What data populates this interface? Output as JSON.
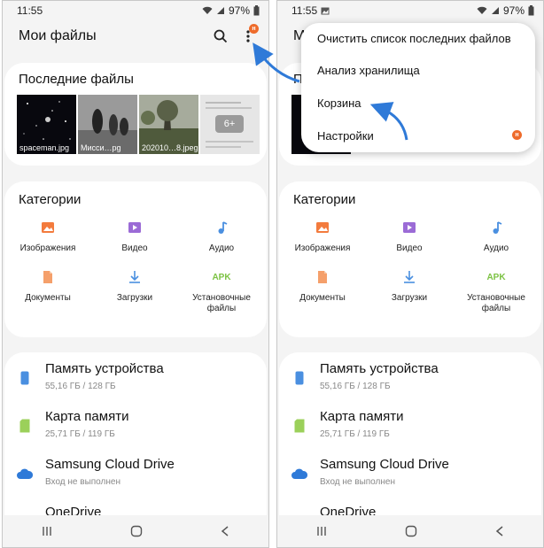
{
  "status": {
    "time": "11:55",
    "battery": "97%"
  },
  "appbar": {
    "title": "Мои файлы",
    "title_partial": "Мо",
    "badge": "н"
  },
  "recent": {
    "title": "Последние файлы",
    "title_partial": "П",
    "files": [
      {
        "name": "spaceman.jpg"
      },
      {
        "name": "Мисси…pg"
      },
      {
        "name": "202010…8.jpeg"
      },
      {
        "name": "6+"
      }
    ]
  },
  "categories": {
    "title": "Категории",
    "items": [
      {
        "label": "Изображения",
        "icon": "image-icon",
        "color": "#f37b3d"
      },
      {
        "label": "Видео",
        "icon": "video-icon",
        "color": "#9b6bd6"
      },
      {
        "label": "Аудио",
        "icon": "audio-icon",
        "color": "#4a8fe0"
      },
      {
        "label": "Документы",
        "icon": "document-icon",
        "color": "#f5a06b"
      },
      {
        "label": "Загрузки",
        "icon": "download-icon",
        "color": "#4a8fe0"
      },
      {
        "label": "Установочные файлы",
        "icon": "apk-icon",
        "color": "#7cc243",
        "icon_text": "APK"
      }
    ]
  },
  "storage": {
    "items": [
      {
        "name": "Память устройства",
        "sub": "55,16 ГБ / 128 ГБ",
        "icon": "phone-icon"
      },
      {
        "name": "Карта памяти",
        "sub": "25,71 ГБ / 119 ГБ",
        "icon": "sd-card-icon"
      },
      {
        "name": "Samsung Cloud Drive",
        "sub": "Вход не выполнен",
        "icon": "cloud-icon"
      },
      {
        "name": "OneDrive",
        "sub": "",
        "icon": "onedrive-icon"
      }
    ]
  },
  "menu": {
    "items": [
      {
        "label": "Очистить список последних файлов"
      },
      {
        "label": "Анализ хранилища"
      },
      {
        "label": "Корзина"
      },
      {
        "label": "Настройки"
      }
    ],
    "badge": "н"
  },
  "colors": {
    "accent": "#2f7ad8",
    "badge": "#ee6b2b",
    "card": "#ffffff",
    "background": "#f4f4f4"
  }
}
